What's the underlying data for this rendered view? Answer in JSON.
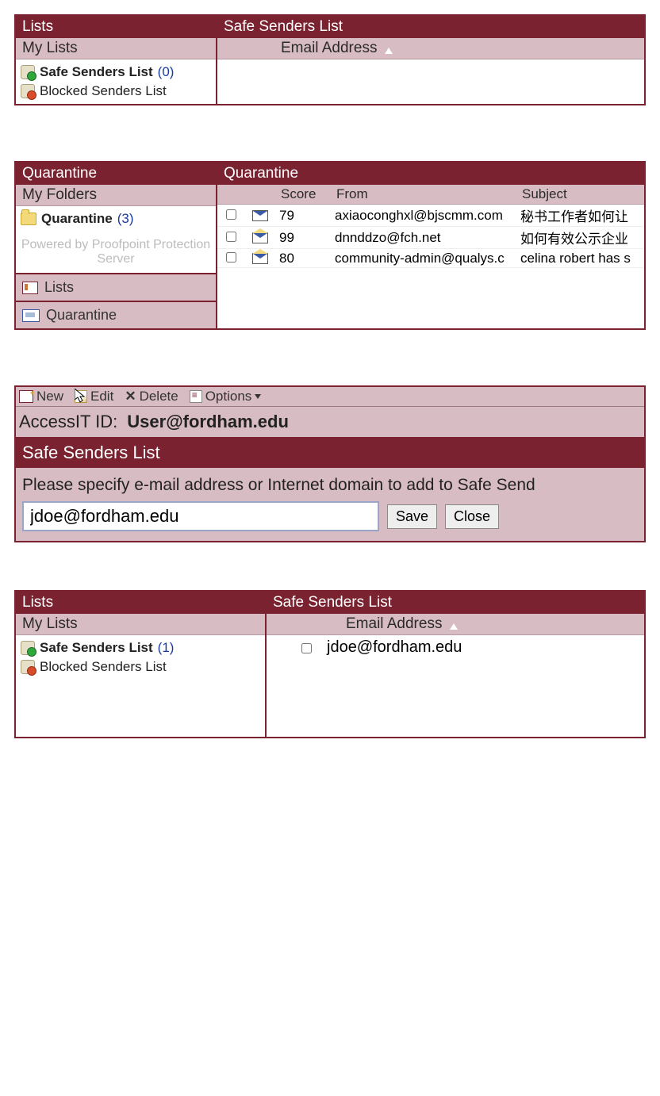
{
  "panel1": {
    "left_title": "Lists",
    "subtitle": "My Lists",
    "items": [
      {
        "label": "Safe Senders List",
        "count": "(0)",
        "bold": true,
        "icon": "shield-green"
      },
      {
        "label": "Blocked Senders List",
        "count": "",
        "bold": false,
        "icon": "shield-red"
      }
    ],
    "right_title": "Safe Senders List",
    "column_header": "Email Address"
  },
  "panel2": {
    "left_title": "Quarantine",
    "subtitle": "My Folders",
    "folder": {
      "label": "Quarantine",
      "count": "(3)"
    },
    "powered": "Powered by Proofpoint Protection Server",
    "nav": [
      {
        "label": "Lists",
        "icon": "lists"
      },
      {
        "label": "Quarantine",
        "icon": "quar"
      }
    ],
    "right_title": "Quarantine",
    "columns": {
      "score": "Score",
      "from": "From",
      "subject": "Subject"
    },
    "rows": [
      {
        "score": "79",
        "from": "axiaoconghxl@bjscmm.com",
        "subject": "秘书工作者如何让",
        "open": false
      },
      {
        "score": "99",
        "from": "dnnddzo@fch.net",
        "subject": "如何有效公示企业",
        "open": true
      },
      {
        "score": "80",
        "from": "community-admin@qualys.c",
        "subject": "celina robert has s",
        "open": true
      }
    ]
  },
  "panel3": {
    "toolbar": {
      "new": "New",
      "edit": "Edit",
      "delete": "Delete",
      "options": "Options"
    },
    "accessit_label": "AccessIT ID:",
    "accessit_value": "User@fordham.edu",
    "section_title": "Safe Senders List",
    "instruction": "Please specify e-mail address or Internet domain to add to Safe Send",
    "input_value": "jdoe@fordham.edu",
    "save": "Save",
    "close": "Close"
  },
  "panel4": {
    "left_title": "Lists",
    "subtitle": "My Lists",
    "items": [
      {
        "label": "Safe Senders List",
        "count": "(1)",
        "bold": true,
        "icon": "shield-green"
      },
      {
        "label": "Blocked Senders List",
        "count": "",
        "bold": false,
        "icon": "shield-red"
      }
    ],
    "right_title": "Safe Senders List",
    "column_header": "Email Address",
    "row_value": "jdoe@fordham.edu"
  }
}
